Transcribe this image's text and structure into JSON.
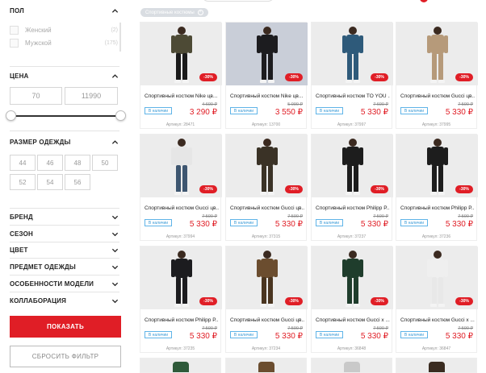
{
  "filters": {
    "gender": {
      "title": "ПОЛ",
      "options": [
        {
          "label": "Женский",
          "count": "(2)"
        },
        {
          "label": "Мужской",
          "count": "(175)"
        }
      ]
    },
    "price": {
      "title": "ЦЕНА",
      "min_value": "70",
      "max_value": "11990"
    },
    "size": {
      "title": "РАЗМЕР ОДЕЖДЫ",
      "options": [
        "44",
        "46",
        "48",
        "50",
        "52",
        "54",
        "56"
      ]
    },
    "collapsed": [
      {
        "title": "БРЕНД"
      },
      {
        "title": "СЕЗОН"
      },
      {
        "title": "ЦВЕТ"
      },
      {
        "title": "ПРЕДМЕТ ОДЕЖДЫ"
      },
      {
        "title": "ОСОБЕННОСТИ МОДЕЛИ"
      },
      {
        "title": "КОЛЛАБОРАЦИЯ"
      }
    ],
    "show_button": "ПОКАЗАТЬ",
    "reset_button": "СБРОСИТЬ ФИЛЬТР"
  },
  "active_chip": {
    "label": "Спортивные костюмы"
  },
  "colors": {
    "accent": "#e01e26",
    "stock": "#3a9ad6"
  },
  "products": [
    {
      "title": "Спортивный костюм Nike цв...",
      "stock": "В наличии",
      "old_price": "4 690 ₽",
      "price": "3 290 ₽",
      "sku": "Артикул: 28471",
      "discount": "-30%",
      "outfit": "olive"
    },
    {
      "title": "Спортивный костюм Nike цв...",
      "stock": "В наличии",
      "old_price": "5 090 ₽",
      "price": "3 550 ₽",
      "sku": "Артикул: 13700",
      "discount": "-30%",
      "outfit": "black"
    },
    {
      "title": "Спортивный костюм TO YOU ...",
      "stock": "В наличии",
      "old_price": "7 690 ₽",
      "price": "5 330 ₽",
      "sku": "Артикул: 37997",
      "discount": "-30%",
      "outfit": "navy"
    },
    {
      "title": "Спортивный костюм Gucci цв...",
      "stock": "В наличии",
      "old_price": "7 590 ₽",
      "price": "5 330 ₽",
      "sku": "Артикул: 37995",
      "discount": "-30%",
      "outfit": "beige"
    },
    {
      "title": "Спортивный костюм Gucci цв...",
      "stock": "В наличии",
      "old_price": "7 590 ₽",
      "price": "5 330 ₽",
      "sku": "Артикул: 37994",
      "discount": "-30%",
      "outfit": "blue-white"
    },
    {
      "title": "Спортивный костюм Gucci цв...",
      "stock": "В наличии",
      "old_price": "7 590 ₽",
      "price": "5 330 ₽",
      "sku": "Артикул: 37315",
      "discount": "-30%",
      "outfit": "pattern-dark"
    },
    {
      "title": "Спортивный костюм Philipp P...",
      "stock": "В наличии",
      "old_price": "7 590 ₽",
      "price": "5 330 ₽",
      "sku": "Артикул: 37237",
      "discount": "-30%",
      "outfit": "black-gold"
    },
    {
      "title": "Спортивный костюм Philipp P...",
      "stock": "В наличии",
      "old_price": "7 590 ₽",
      "price": "5 330 ₽",
      "sku": "Артикул: 37236",
      "discount": "-30%",
      "outfit": "black-gold"
    },
    {
      "title": "Спортивный костюм Philipp P...",
      "stock": "В наличии",
      "old_price": "7 590 ₽",
      "price": "5 330 ₽",
      "sku": "Артикул: 37235",
      "discount": "-30%",
      "outfit": "black"
    },
    {
      "title": "Спортивный костюм Gucci цв...",
      "stock": "В наличии",
      "old_price": "7 590 ₽",
      "price": "5 330 ₽",
      "sku": "Артикул: 37234",
      "discount": "-30%",
      "outfit": "pattern-brown"
    },
    {
      "title": "Спортивный костюм Gucci х ...",
      "stock": "В наличии",
      "old_price": "7 590 ₽",
      "price": "5 330 ₽",
      "sku": "Артикул: 36848",
      "discount": "-30%",
      "outfit": "green"
    },
    {
      "title": "Спортивный костюм Gucci х ...",
      "stock": "В наличии",
      "old_price": "7 590 ₽",
      "price": "5 330 ₽",
      "sku": "Артикул: 36847",
      "discount": "-30%",
      "outfit": "white"
    }
  ]
}
